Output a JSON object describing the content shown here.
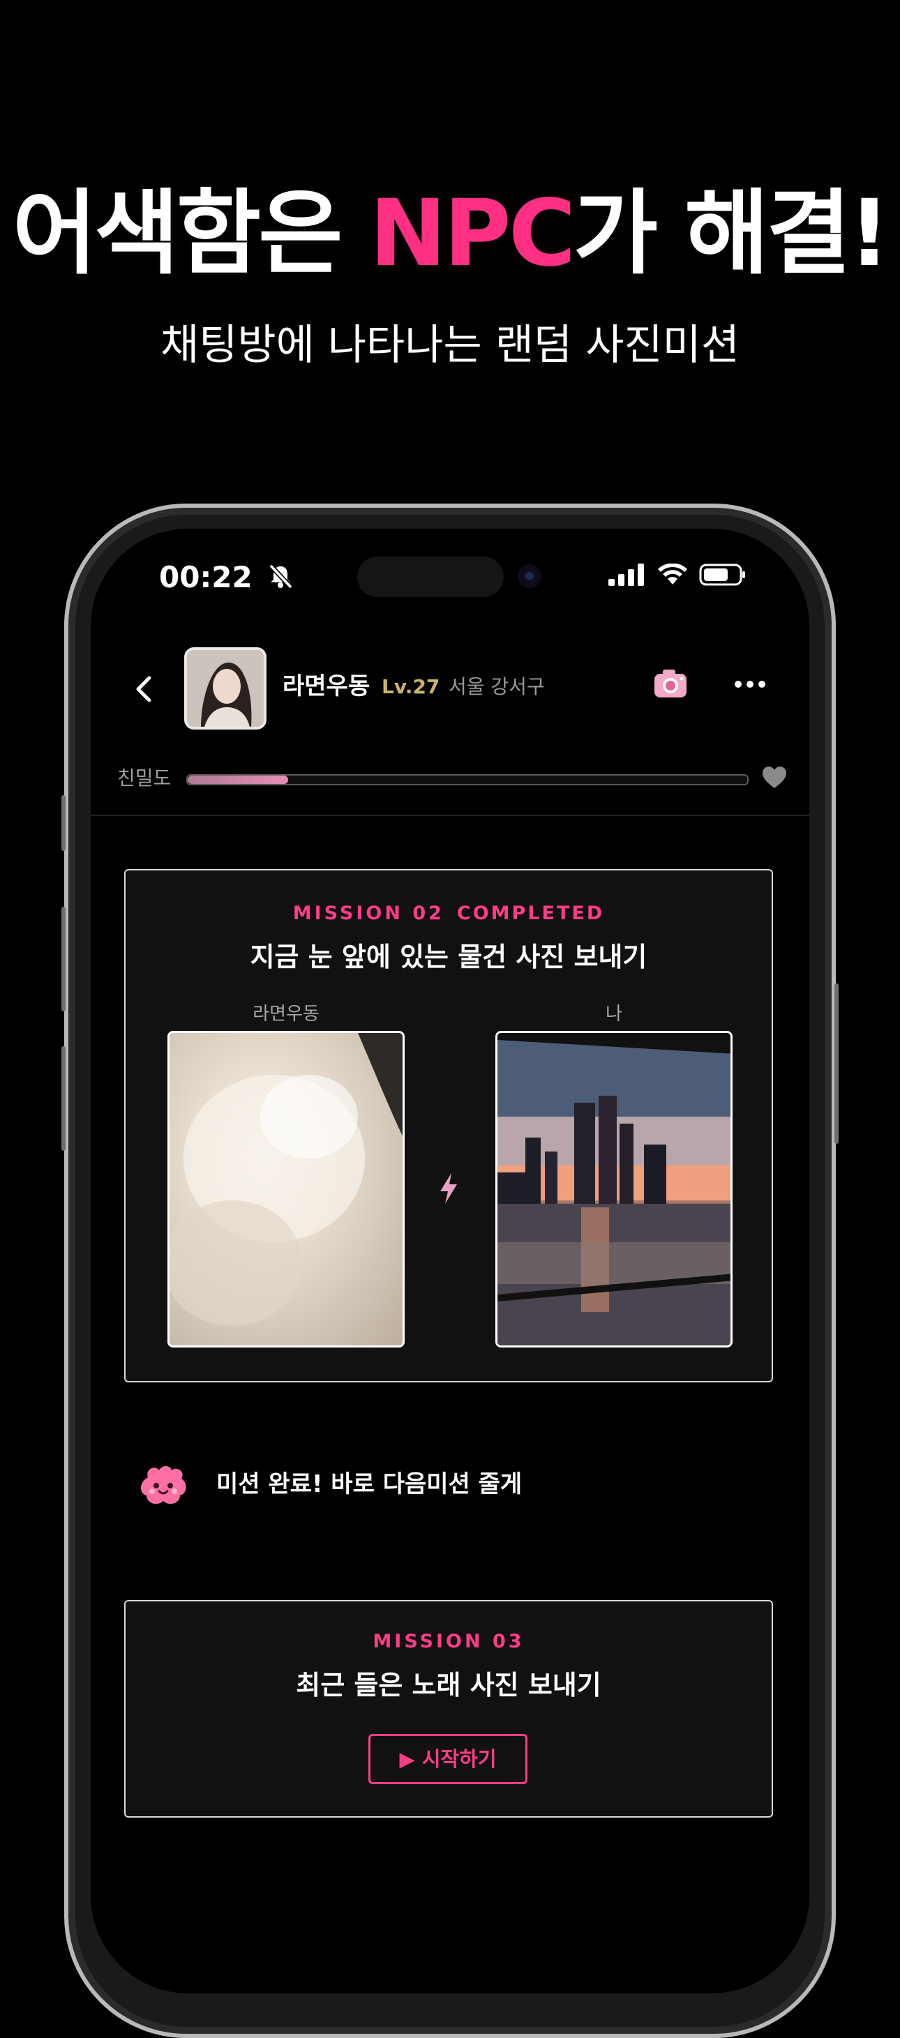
{
  "promo": {
    "headline_before": "어색함은 ",
    "headline_accent": "NPC",
    "headline_after": "가 해결!",
    "subheadline": "채팅방에 나타나는 랜덤 사진미션"
  },
  "status_bar": {
    "time": "00:22"
  },
  "chat_header": {
    "name": "라면우동",
    "level": "Lv.27",
    "location": "서울 강서구"
  },
  "intimacy": {
    "label": "친밀도",
    "level_fraction": 0.18
  },
  "mission_completed": {
    "tag": "MISSION 02",
    "status": "COMPLETED",
    "title": "지금 눈 앞에 있는 물건 사진 보내기",
    "left_label": "라면우동",
    "right_label": "나"
  },
  "npc": {
    "message": "미션 완료! 바로 다음미션 줄게"
  },
  "mission_next": {
    "tag": "MISSION 03",
    "title": "최근 들은 노래 사진 보내기",
    "start_label": "▶ 시작하기"
  },
  "colors": {
    "accent": "#ff2f84",
    "level_gold": "#c9b46a",
    "background": "#000000"
  }
}
